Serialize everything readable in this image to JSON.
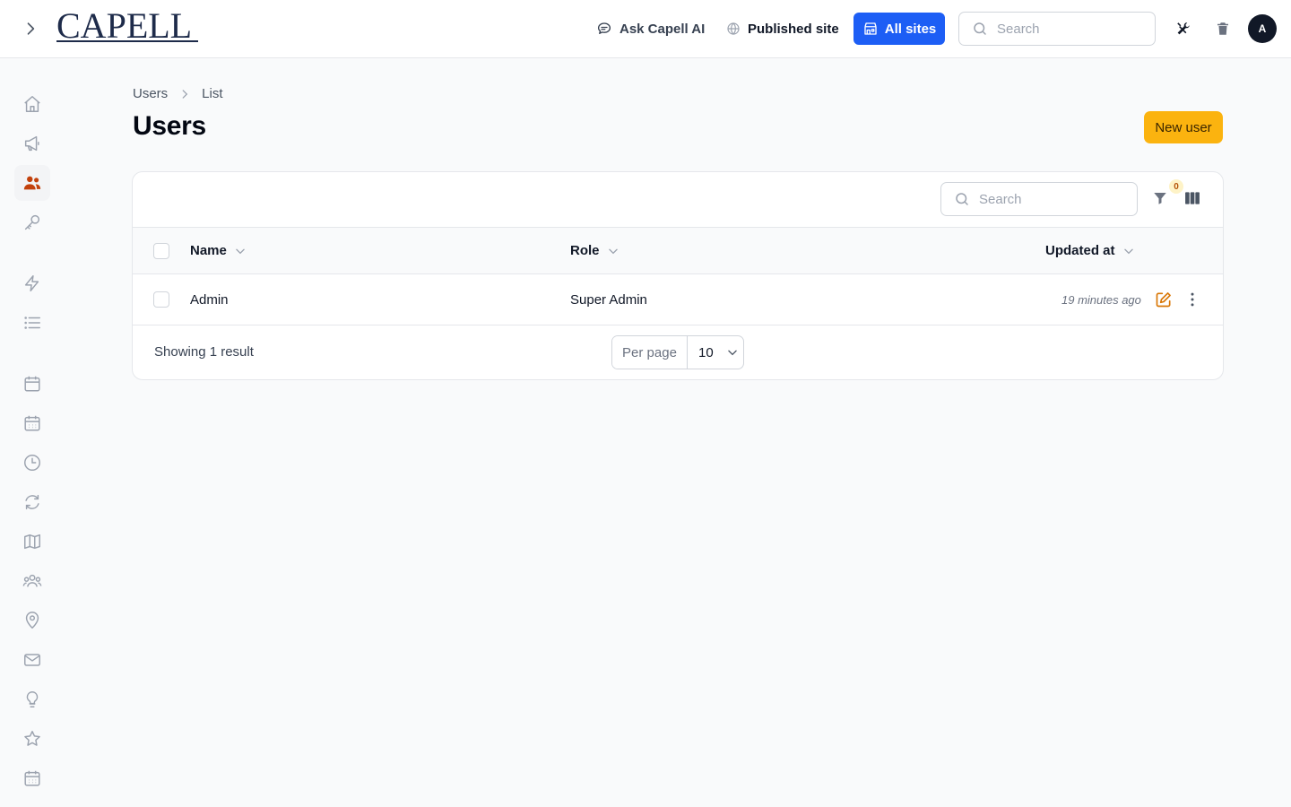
{
  "topbar": {
    "logo_text": "CAPELL",
    "ask_ai_label": "Ask Capell AI",
    "published_site_label": "Published site",
    "all_sites_label": "All sites",
    "search_placeholder": "Search",
    "avatar_initial": "A",
    "accent_color": "#1d5ef5"
  },
  "breadcrumb": {
    "items": [
      "Users",
      "List"
    ]
  },
  "page": {
    "title": "Users",
    "new_user_label": "New user",
    "new_user_color": "#fbb30f"
  },
  "table": {
    "search_placeholder": "Search",
    "filter_count": "0",
    "columns": [
      "Name",
      "Role",
      "Updated at"
    ],
    "rows": [
      {
        "name": "Admin",
        "role": "Super Admin",
        "updated_at": "19 minutes ago"
      }
    ],
    "footer": {
      "showing": "Showing 1 result",
      "per_page_label": "Per page",
      "per_page_value": "10"
    }
  },
  "sidebar": {
    "icons": [
      "home-icon",
      "megaphone-icon",
      "users-icon",
      "key-icon",
      "bolt-icon",
      "list-icon",
      "calendar-icon",
      "calendar-days-icon",
      "clock-icon",
      "refresh-icon",
      "map-icon",
      "user-group-icon",
      "map-pin-icon",
      "envelope-icon",
      "lightbulb-icon",
      "star-icon",
      "calendar-days-icon"
    ],
    "active_index": 2,
    "active_color": "#c2410c"
  }
}
